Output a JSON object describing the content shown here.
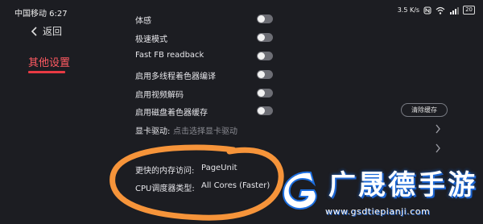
{
  "status_bar": {
    "carrier_time": "中国移动 6:27",
    "network_speed": "3.5 K/s",
    "icons": [
      "nfc-icon",
      "wifi-icon",
      "signal-icon",
      "battery-icon"
    ],
    "battery": "20"
  },
  "nav": {
    "back_label": "返回",
    "section_tab": "其他设置"
  },
  "settings": {
    "rows": [
      {
        "label": "体感",
        "toggle_on": false
      },
      {
        "label": "极速模式",
        "toggle_on": false
      },
      {
        "label": "Fast FB readback",
        "toggle_on": false
      },
      {
        "label": "启用多线程着色器编译",
        "toggle_on": false
      },
      {
        "label": "启用视频解码",
        "toggle_on": false
      },
      {
        "label": "启用磁盘着色器缓存",
        "toggle_on": false
      }
    ],
    "clear_cache_label": "清除缓存",
    "gpu_driver_label": "显卡驱动:",
    "gpu_driver_hint": "点击选择显卡驱动",
    "memory_access_label": "更快的内存访问:",
    "memory_access_value": "PageUnit",
    "cpu_scheduler_label": "CPU调度器类型:",
    "cpu_scheduler_value": "All Cores (Faster)"
  },
  "colors": {
    "background": "#1c1d22",
    "accent": "#e83a44",
    "annotation": "#f6943a",
    "watermark": "#1d6fe0"
  },
  "watermark": {
    "title": "广晟德手游",
    "url": "www.gsdtiepianji.com"
  }
}
